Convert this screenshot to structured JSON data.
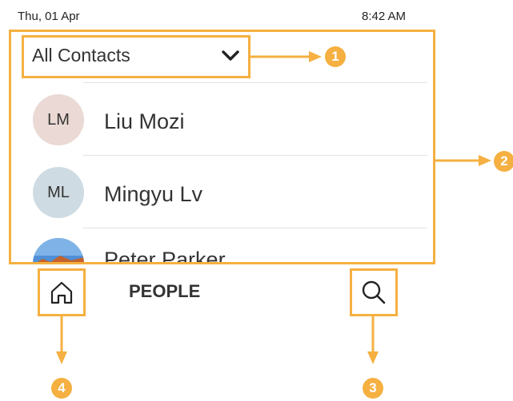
{
  "status_bar": {
    "date": "Thu, 01 Apr",
    "time": "8:42 AM"
  },
  "filter": {
    "selected": "All Contacts",
    "icon": "chevron-down-icon"
  },
  "contacts": [
    {
      "initials": "LM",
      "name": "Liu Mozi",
      "avatar_color": "#ead9d4"
    },
    {
      "initials": "ML",
      "name": "Mingyu Lv",
      "avatar_color": "#cfdbe2"
    },
    {
      "initials": "",
      "name": "Peter Parker",
      "avatar_type": "photo"
    }
  ],
  "bottom_bar": {
    "home_icon": "home-icon",
    "tab_label": "PEOPLE",
    "search_icon": "search-icon"
  },
  "callouts": {
    "c1": "1",
    "c2": "2",
    "c3": "3",
    "c4": "4"
  },
  "colors": {
    "highlight": "#f5b041"
  }
}
